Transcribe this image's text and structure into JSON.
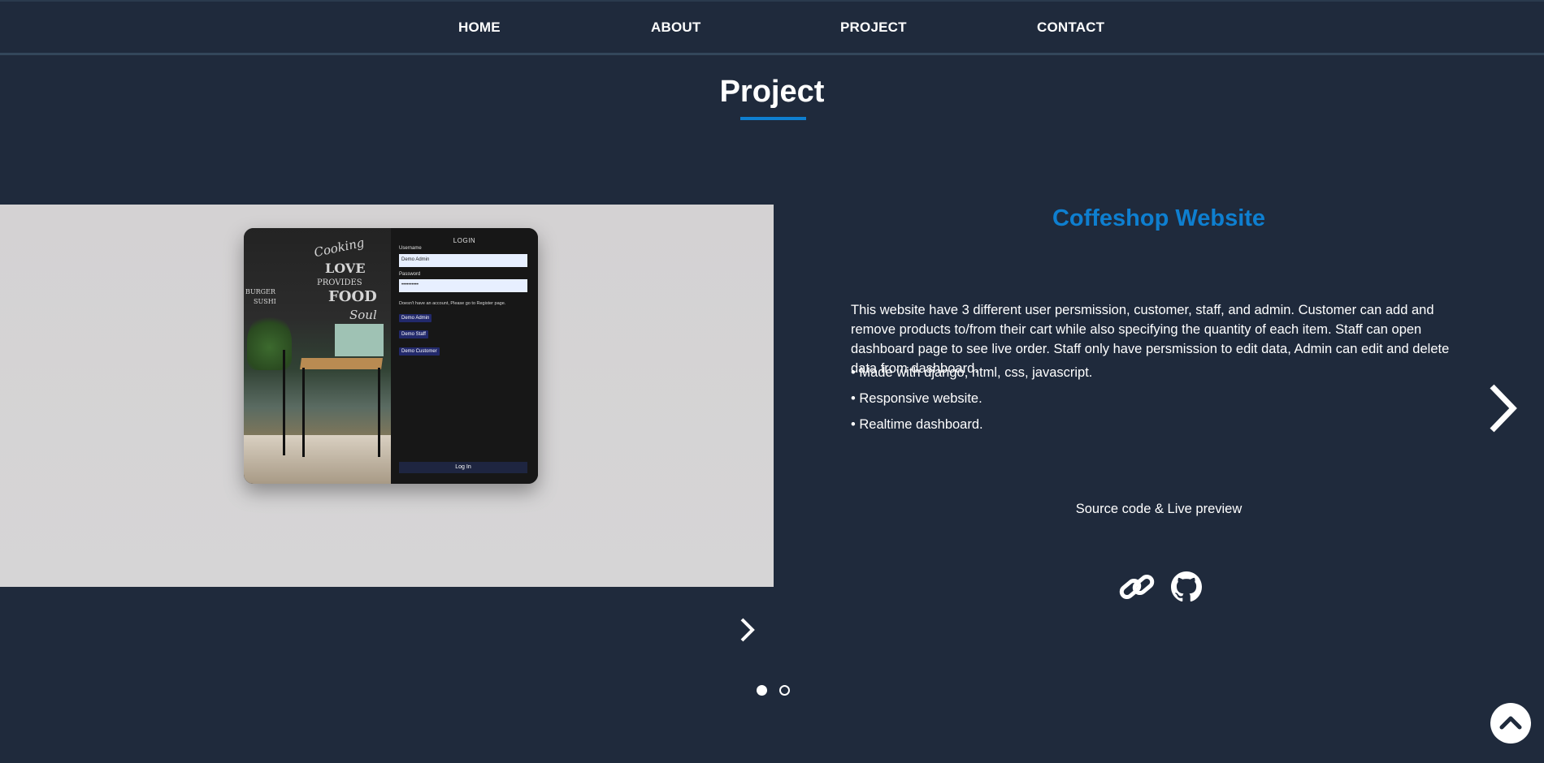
{
  "nav": {
    "items": [
      {
        "label": "HOME"
      },
      {
        "label": "ABOUT"
      },
      {
        "label": "PROJECT"
      },
      {
        "label": "CONTACT"
      }
    ]
  },
  "section": {
    "title": "Project"
  },
  "screenshot": {
    "mural_lines": [
      "Cooking",
      "LOVE",
      "PROVIDES",
      "FOOD",
      "Soul",
      "BURGER",
      "SUSHI"
    ],
    "login_title": "LOGIN",
    "username_label": "Username",
    "username_value": "Demo Admin",
    "password_label": "Password",
    "password_value": "••••••••••",
    "note": "Doesn't have an account, Please go to Register page.",
    "demo_buttons": [
      "Demo Admin",
      "Demo Staff",
      "Demo Customer"
    ],
    "login_button": "Log In"
  },
  "project": {
    "title": "Coffeshop Website",
    "description": "This website have 3 different user persmission, customer, staff, and admin. Customer can add and remove products to/from their cart while also specifying the quantity of each item. Staff can open dashboard page to see live order. Staff only have persmission to edit data, Admin can edit and delete data from dashboard.",
    "features": [
      "• Made with django, html, css, javascript.",
      "• Responsive website.",
      "• Realtime dashboard."
    ],
    "source_label": "Source code & Live preview",
    "links": [
      {
        "icon": "link-icon"
      },
      {
        "icon": "github-icon"
      }
    ]
  },
  "carousel": {
    "slides": 2,
    "active": 1
  },
  "colors": {
    "background": "#1f2a3c",
    "accent": "#0e7fd0",
    "text": "#ffffff"
  }
}
